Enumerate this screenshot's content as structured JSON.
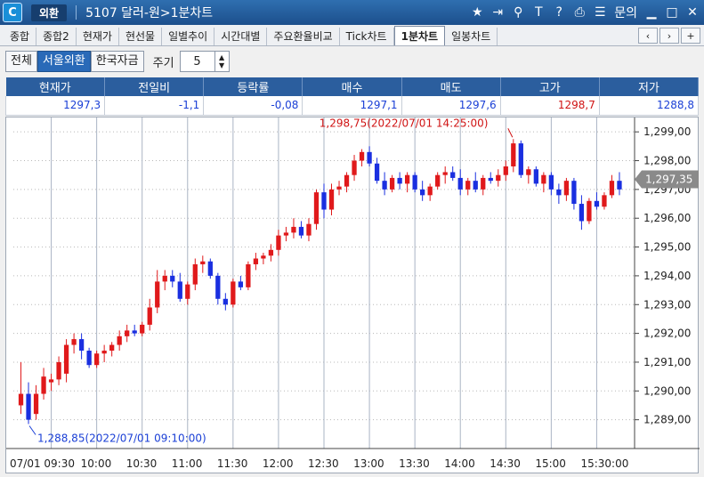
{
  "titlebar": {
    "logo_glyph": "C",
    "badge": "외환",
    "title": "5107 달러-원>1분차트",
    "icons": [
      "star-icon",
      "export-icon",
      "link-icon",
      "text-icon",
      "help-icon",
      "print-icon",
      "list-icon"
    ],
    "inquiry": "문의"
  },
  "tabs": [
    "종합",
    "종합2",
    "현재가",
    "현선물",
    "일별추이",
    "시간대별",
    "주요환율비교",
    "Tick차트",
    "1분차트",
    "일봉차트"
  ],
  "active_tab": "1분차트",
  "controls": {
    "segments": [
      "전체",
      "서울외환",
      "한국자금"
    ],
    "active_segment": "서울외환",
    "period_label": "주기",
    "period_value": "5"
  },
  "quote": {
    "headers": [
      "현재가",
      "전일비",
      "등락률",
      "매수",
      "매도",
      "고가",
      "저가"
    ],
    "values": [
      "1297,3",
      "-1,1",
      "-0,08",
      "1297,1",
      "1297,6",
      "1298,7",
      "1288,8"
    ],
    "colors": [
      "blue",
      "blue",
      "blue",
      "blue",
      "blue",
      "red",
      "blue"
    ]
  },
  "colors": {
    "up": "#e0191b",
    "down": "#1a2fe0",
    "current_tag": "#8a8a8a"
  },
  "chart_data": {
    "type": "candlestick",
    "x_ticks": [
      "07/01 09:30",
      "10:00",
      "10:30",
      "11:00",
      "11:30",
      "12:00",
      "12:30",
      "13:00",
      "13:30",
      "14:00",
      "14:30",
      "15:00",
      "15:30:00"
    ],
    "y_ticks": [
      "1,289,00",
      "1,290,00",
      "1,291,00",
      "1,292,00",
      "1,293,00",
      "1,294,00",
      "1,295,00",
      "1,296,00",
      "1,297,00",
      "1,298,00",
      "1,299,00"
    ],
    "ylim": [
      1288.0,
      1299.5
    ],
    "grid": true,
    "current_value": 1297.35,
    "current_label": "1,297,35",
    "annotations": [
      {
        "text": "1,298,75(2022/07/01 14:25:00)",
        "color": "red",
        "value": 1298.75
      },
      {
        "text": "1,288,85(2022/07/01 09:10:00)",
        "color": "blue",
        "value": 1288.85
      }
    ],
    "candles": [
      [
        1289.5,
        1291.0,
        1289.2,
        1289.9
      ],
      [
        1289.9,
        1290.3,
        1288.85,
        1289.0
      ],
      [
        1289.2,
        1290.2,
        1289.0,
        1289.9
      ],
      [
        1289.9,
        1290.8,
        1289.7,
        1290.5
      ],
      [
        1290.3,
        1290.6,
        1290.0,
        1290.4
      ],
      [
        1290.4,
        1291.2,
        1290.2,
        1291.0
      ],
      [
        1290.6,
        1291.8,
        1290.3,
        1291.6
      ],
      [
        1291.6,
        1292.0,
        1291.3,
        1291.8
      ],
      [
        1291.8,
        1292.0,
        1291.1,
        1291.4
      ],
      [
        1291.4,
        1291.5,
        1290.8,
        1290.9
      ],
      [
        1290.9,
        1291.4,
        1290.8,
        1291.3
      ],
      [
        1291.3,
        1291.6,
        1291.0,
        1291.4
      ],
      [
        1291.4,
        1291.7,
        1291.2,
        1291.6
      ],
      [
        1291.6,
        1292.1,
        1291.4,
        1291.9
      ],
      [
        1291.9,
        1292.3,
        1291.7,
        1292.1
      ],
      [
        1292.1,
        1292.3,
        1291.9,
        1292.0
      ],
      [
        1292.0,
        1292.4,
        1291.9,
        1292.3
      ],
      [
        1292.3,
        1293.2,
        1292.1,
        1292.9
      ],
      [
        1292.9,
        1294.2,
        1292.7,
        1293.8
      ],
      [
        1293.8,
        1294.2,
        1293.5,
        1294.0
      ],
      [
        1294.0,
        1294.2,
        1293.6,
        1293.8
      ],
      [
        1293.8,
        1294.1,
        1293.1,
        1293.2
      ],
      [
        1293.2,
        1293.8,
        1293.0,
        1293.7
      ],
      [
        1293.7,
        1294.6,
        1293.5,
        1294.4
      ],
      [
        1294.4,
        1294.7,
        1294.1,
        1294.5
      ],
      [
        1294.5,
        1294.6,
        1293.9,
        1294.0
      ],
      [
        1294.0,
        1294.1,
        1293.0,
        1293.2
      ],
      [
        1293.2,
        1293.4,
        1292.8,
        1293.0
      ],
      [
        1293.0,
        1293.9,
        1292.9,
        1293.8
      ],
      [
        1293.8,
        1294.0,
        1293.5,
        1293.6
      ],
      [
        1293.6,
        1294.5,
        1293.5,
        1294.4
      ],
      [
        1294.4,
        1294.8,
        1294.2,
        1294.6
      ],
      [
        1294.6,
        1294.8,
        1294.4,
        1294.7
      ],
      [
        1294.7,
        1295.1,
        1294.5,
        1294.9
      ],
      [
        1294.9,
        1295.6,
        1294.7,
        1295.4
      ],
      [
        1295.4,
        1295.7,
        1295.2,
        1295.5
      ],
      [
        1295.5,
        1296.0,
        1295.3,
        1295.7
      ],
      [
        1295.7,
        1295.9,
        1295.3,
        1295.4
      ],
      [
        1295.4,
        1296.0,
        1295.2,
        1295.8
      ],
      [
        1295.8,
        1297.0,
        1295.6,
        1296.9
      ],
      [
        1296.9,
        1297.2,
        1296.0,
        1296.3
      ],
      [
        1296.3,
        1297.2,
        1296.1,
        1297.0
      ],
      [
        1297.0,
        1297.3,
        1296.8,
        1297.1
      ],
      [
        1297.1,
        1297.6,
        1296.9,
        1297.5
      ],
      [
        1297.5,
        1298.2,
        1297.3,
        1298.0
      ],
      [
        1298.0,
        1298.4,
        1297.8,
        1298.3
      ],
      [
        1298.3,
        1298.5,
        1297.8,
        1297.9
      ],
      [
        1297.9,
        1298.1,
        1297.2,
        1297.3
      ],
      [
        1297.3,
        1297.6,
        1296.8,
        1297.0
      ],
      [
        1297.0,
        1297.5,
        1296.9,
        1297.4
      ],
      [
        1297.4,
        1297.6,
        1297.0,
        1297.2
      ],
      [
        1297.2,
        1297.6,
        1296.9,
        1297.5
      ],
      [
        1297.5,
        1297.6,
        1296.9,
        1297.0
      ],
      [
        1297.0,
        1297.3,
        1296.6,
        1296.8
      ],
      [
        1296.8,
        1297.2,
        1296.6,
        1297.1
      ],
      [
        1297.1,
        1297.6,
        1297.0,
        1297.5
      ],
      [
        1297.5,
        1297.8,
        1297.2,
        1297.6
      ],
      [
        1297.6,
        1297.8,
        1297.3,
        1297.4
      ],
      [
        1297.4,
        1297.7,
        1296.8,
        1297.0
      ],
      [
        1297.0,
        1297.4,
        1296.8,
        1297.3
      ],
      [
        1297.3,
        1297.6,
        1296.9,
        1297.0
      ],
      [
        1297.0,
        1297.5,
        1296.8,
        1297.4
      ],
      [
        1297.4,
        1297.6,
        1297.2,
        1297.3
      ],
      [
        1297.3,
        1297.7,
        1297.1,
        1297.5
      ],
      [
        1297.5,
        1298.0,
        1297.3,
        1297.8
      ],
      [
        1297.8,
        1298.75,
        1297.6,
        1298.6
      ],
      [
        1298.6,
        1298.7,
        1297.4,
        1297.5
      ],
      [
        1297.5,
        1297.8,
        1297.2,
        1297.7
      ],
      [
        1297.7,
        1297.8,
        1297.1,
        1297.2
      ],
      [
        1297.2,
        1297.6,
        1296.9,
        1297.5
      ],
      [
        1297.5,
        1297.6,
        1296.8,
        1297.0
      ],
      [
        1297.0,
        1297.2,
        1296.5,
        1296.8
      ],
      [
        1296.8,
        1297.4,
        1296.6,
        1297.3
      ],
      [
        1297.3,
        1297.4,
        1296.3,
        1296.5
      ],
      [
        1296.5,
        1296.8,
        1295.6,
        1295.9
      ],
      [
        1295.9,
        1296.7,
        1295.8,
        1296.6
      ],
      [
        1296.6,
        1296.9,
        1296.3,
        1296.4
      ],
      [
        1296.4,
        1296.9,
        1296.3,
        1296.8
      ],
      [
        1296.8,
        1297.5,
        1296.7,
        1297.3
      ],
      [
        1297.3,
        1297.6,
        1296.8,
        1297.0
      ]
    ]
  }
}
